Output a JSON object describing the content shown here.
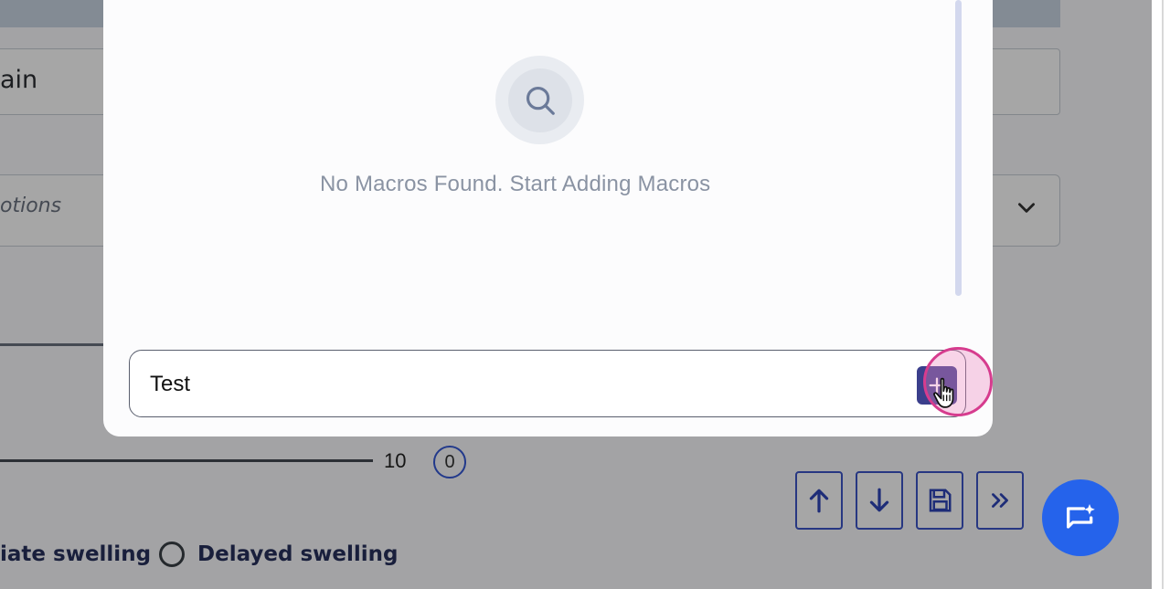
{
  "background": {
    "field_text": "ain",
    "select_placeholder": "otions",
    "slider_max": "10",
    "slider_value": "0",
    "radio_options": [
      {
        "label": "iate swelling"
      },
      {
        "label": "Delayed swelling"
      }
    ],
    "toolbar": [
      "arrow-up-icon",
      "arrow-down-icon",
      "save-icon",
      "double-chevron-right-icon"
    ]
  },
  "modal": {
    "empty_icon": "search-icon",
    "empty_message": "No Macros Found. Start Adding Macros",
    "input_value": "Test",
    "add_button_icon": "plus-icon"
  },
  "chat_fab_icon": "chat-sparkle-icon",
  "colors": {
    "primary": "#2563eb",
    "add_button": "#3b3f8c",
    "highlight": "#d63c8e"
  }
}
